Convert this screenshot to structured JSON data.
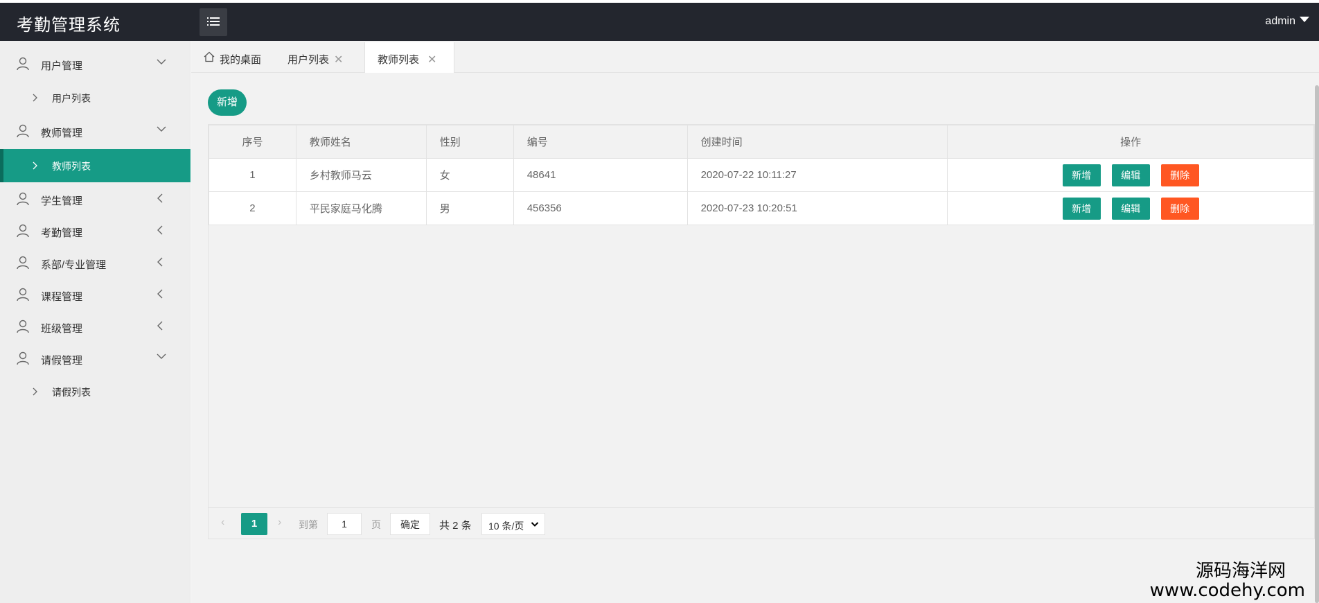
{
  "header": {
    "app_title": "考勤管理系统",
    "user": "admin"
  },
  "sidebar": {
    "groups": [
      {
        "label": "用户管理",
        "expanded": true,
        "items": [
          {
            "label": "用户列表"
          }
        ]
      },
      {
        "label": "教师管理",
        "expanded": true,
        "items": [
          {
            "label": "教师列表",
            "active": true
          }
        ]
      },
      {
        "label": "学生管理",
        "expanded": false
      },
      {
        "label": "考勤管理",
        "expanded": false
      },
      {
        "label": "系部/专业管理",
        "expanded": false
      },
      {
        "label": "课程管理",
        "expanded": false
      },
      {
        "label": "班级管理",
        "expanded": false
      },
      {
        "label": "请假管理",
        "expanded": true,
        "items": [
          {
            "label": "请假列表"
          }
        ]
      }
    ]
  },
  "tabs": [
    {
      "label": "我的桌面",
      "closable": false,
      "icon": "home-icon"
    },
    {
      "label": "用户列表",
      "closable": true
    },
    {
      "label": "教师列表",
      "closable": true,
      "active": true
    }
  ],
  "toolbar": {
    "add_label": "新增"
  },
  "table": {
    "columns": [
      "序号",
      "教师姓名",
      "性别",
      "编号",
      "创建时间",
      "操作"
    ],
    "rows": [
      {
        "index": "1",
        "name": "乡村教师马云",
        "gender": "女",
        "number": "48641",
        "created": "2020-07-22 10:11:27"
      },
      {
        "index": "2",
        "name": "平民家庭马化腾",
        "gender": "男",
        "number": "456356",
        "created": "2020-07-23 10:20:51"
      }
    ],
    "actions": {
      "add": "新增",
      "edit": "编辑",
      "delete": "删除"
    }
  },
  "pagination": {
    "current_page": "1",
    "goto_prefix": "到第",
    "goto_value": "1",
    "goto_suffix": "页",
    "confirm": "确定",
    "total": "共 2 条",
    "page_size": "10 条/页"
  },
  "watermark": {
    "line1": "源码海洋网",
    "line2": "www.codehy.com"
  },
  "colors": {
    "header_bg": "#23262e",
    "accent": "#169b86",
    "danger": "#ff5722",
    "sidebar_bg": "#eeeeee"
  }
}
